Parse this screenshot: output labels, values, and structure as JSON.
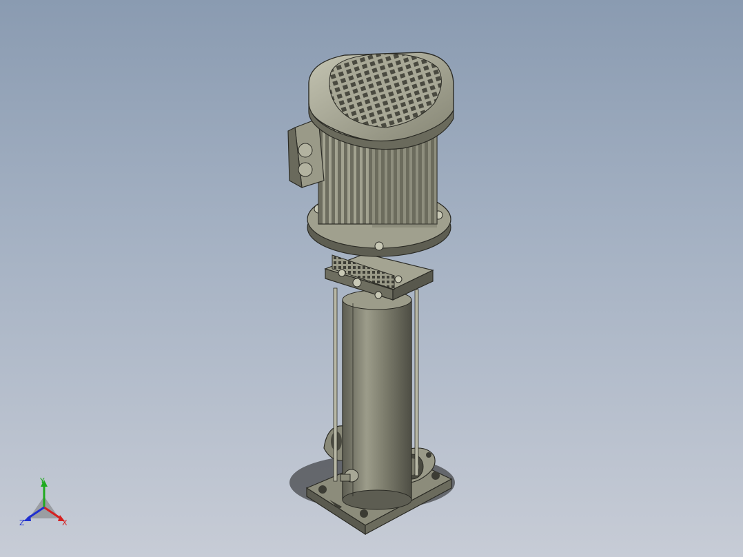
{
  "viewport": {
    "background_top": "#8a9bb1",
    "background_bottom": "#c7ccd6",
    "model_name": "vertical-multistage-pump"
  },
  "triad": {
    "x_label": "X",
    "y_label": "Y",
    "z_label": "Z",
    "x_color": "#d62020",
    "y_color": "#1faa1f",
    "z_color": "#2030d0"
  }
}
